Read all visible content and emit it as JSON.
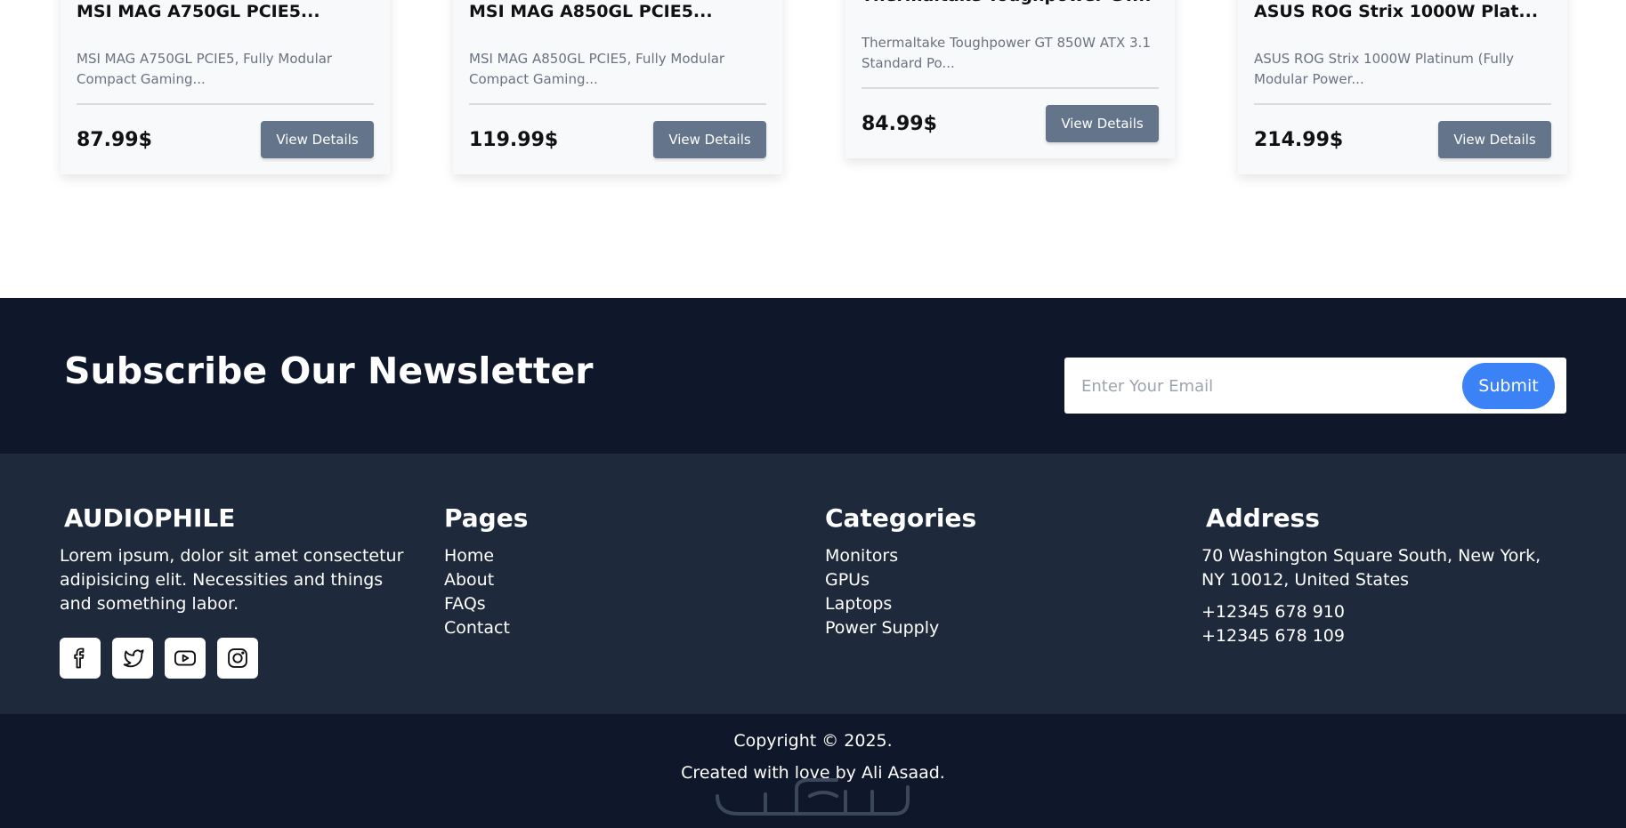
{
  "products": [
    {
      "title": "MSI MAG A750GL PCIE5...",
      "description": "MSI MAG A750GL PCIE5, Fully Modular Compact Gaming...",
      "price": "87.99$",
      "button": "View Details"
    },
    {
      "title": "MSI MAG A850GL PCIE5...",
      "description": "MSI MAG A850GL PCIE5, Fully Modular Compact Gaming...",
      "price": "119.99$",
      "button": "View Details"
    },
    {
      "title": "Thermaltake Toughpower GT...",
      "description": "Thermaltake Toughpower GT 850W ATX 3.1 Standard Po...",
      "price": "84.99$",
      "button": "View Details"
    },
    {
      "title": "ASUS ROG Strix 1000W Plat...",
      "description": "ASUS ROG Strix 1000W Platinum (Fully Modular Power...",
      "price": "214.99$",
      "button": "View Details"
    }
  ],
  "newsletter": {
    "heading": "Subscribe Our Newsletter",
    "email_placeholder": "Enter Your Email",
    "submit_label": "Submit"
  },
  "footer": {
    "brand": {
      "name": "AUDIOPHILE",
      "text": "Lorem ipsum, dolor sit amet consectetur adipisicing elit. Necessities and things and something labor.",
      "socials": [
        "facebook-icon",
        "twitter-icon",
        "youtube-icon",
        "instagram-icon"
      ]
    },
    "pages": {
      "heading": "Pages",
      "items": [
        "Home",
        "About",
        "FAQs",
        "Contact"
      ]
    },
    "categories": {
      "heading": "Categories",
      "items": [
        "Monitors",
        "GPUs",
        "Laptops",
        "Power Supply"
      ]
    },
    "address": {
      "heading": "Address",
      "text": "70 Washington Square South, New York, NY 10012, United States",
      "phones": [
        "+12345 678 910",
        "+12345 678 109"
      ]
    },
    "copyright": "Copyright © 2025.",
    "credit": "Created with love by Ali Asaad."
  },
  "colors": {
    "dark_navy": "#0f172a",
    "slate": "#1e293b",
    "button_gray": "#64748b",
    "accent_blue": "#3b82f6"
  }
}
